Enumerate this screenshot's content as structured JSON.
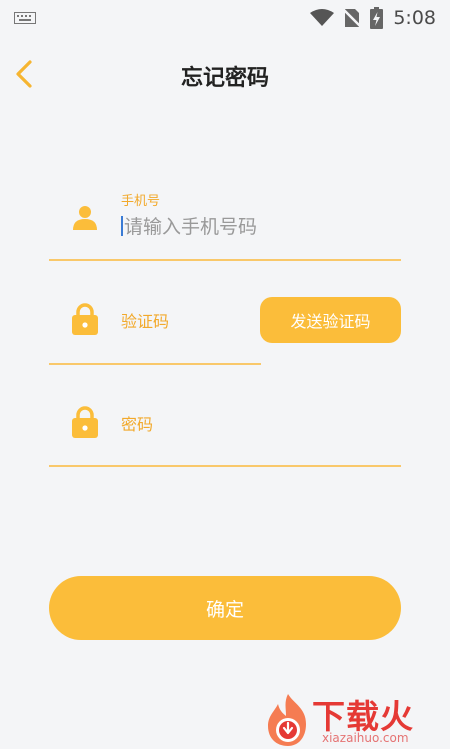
{
  "status_bar": {
    "time": "5:08",
    "icons": [
      "keyboard-icon",
      "wifi-icon",
      "no-sim-icon",
      "battery-charging-icon"
    ]
  },
  "header": {
    "title": "忘记密码",
    "back_icon": "chevron-left-icon"
  },
  "form": {
    "phone": {
      "label": "手机号",
      "placeholder": "请输入手机号码",
      "icon": "person-icon"
    },
    "code": {
      "placeholder": "验证码",
      "icon": "lock-icon",
      "send_button": "发送验证码"
    },
    "password": {
      "placeholder": "密码",
      "icon": "lock-icon"
    }
  },
  "confirm_button": "确定",
  "watermark": {
    "text": "下载火",
    "url": "xiazaihuo.com"
  },
  "colors": {
    "accent": "#fbbd3a",
    "accent_text": "#f2a92b",
    "underline": "#f9c86a",
    "background": "#f4f5f7",
    "watermark": "#e53935"
  }
}
